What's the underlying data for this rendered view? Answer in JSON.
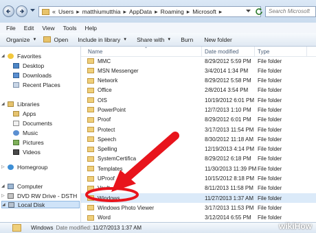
{
  "address": {
    "crumbs": [
      "Users",
      "matthiumutthia",
      "AppData",
      "Roaming",
      "Microsoft"
    ],
    "search_placeholder": "Search Microsoft"
  },
  "menu": [
    "File",
    "Edit",
    "View",
    "Tools",
    "Help"
  ],
  "toolbar": {
    "organize": "Organize",
    "open": "Open",
    "include": "Include in library",
    "share": "Share with",
    "burn": "Burn",
    "new_folder": "New folder"
  },
  "nav": {
    "favorites": "Favorites",
    "desktop": "Desktop",
    "downloads": "Downloads",
    "recent": "Recent Places",
    "libraries": "Libraries",
    "apps": "Apps",
    "documents": "Documents",
    "music": "Music",
    "pictures": "Pictures",
    "videos": "Videos",
    "homegroup": "Homegroup",
    "computer": "Computer",
    "dvd": "DVD RW Drive - DSTH",
    "local_disk": "Local Disk"
  },
  "columns": {
    "name": "Name",
    "date": "Date modified",
    "type": "Type"
  },
  "files": [
    {
      "name": "MMC",
      "date": "8/29/2012 5:59 PM",
      "type": "File folder"
    },
    {
      "name": "MSN Messenger",
      "date": "3/4/2014 1:34 PM",
      "type": "File folder"
    },
    {
      "name": "Network",
      "date": "8/29/2012 5:58 PM",
      "type": "File folder"
    },
    {
      "name": "Office",
      "date": "2/8/2014 3:54 PM",
      "type": "File folder"
    },
    {
      "name": "OIS",
      "date": "10/19/2012 6:01 PM",
      "type": "File folder"
    },
    {
      "name": "PowerPoint",
      "date": "12/7/2013 1:10 PM",
      "type": "File folder"
    },
    {
      "name": "Proof",
      "date": "8/29/2012 6:01 PM",
      "type": "File folder"
    },
    {
      "name": "Protect",
      "date": "3/17/2013 11:54 PM",
      "type": "File folder"
    },
    {
      "name": "Speech",
      "date": "8/30/2012 11:18 AM",
      "type": "File folder"
    },
    {
      "name": "Spelling",
      "date": "12/19/2013 4:14 PM",
      "type": "File folder"
    },
    {
      "name": "SystemCertifica",
      "date": "8/29/2012 6:18 PM",
      "type": "File folder"
    },
    {
      "name": "Templates",
      "date": "11/30/2013 11:39 PM",
      "type": "File folder"
    },
    {
      "name": "UProof",
      "date": "10/15/2012 8:18 PM",
      "type": "File folder"
    },
    {
      "name": "Vault",
      "date": "8/11/2013 11:58 PM",
      "type": "File folder"
    },
    {
      "name": "Windows",
      "date": "11/27/2013 1:37 AM",
      "type": "File folder"
    },
    {
      "name": "Windows Photo Viewer",
      "date": "3/17/2013 11:53 PM",
      "type": "File folder"
    },
    {
      "name": "Word",
      "date": "3/12/2014 6:55 PM",
      "type": "File folder"
    }
  ],
  "selected_index": 14,
  "details": {
    "name": "Windows",
    "label": "Date modified:",
    "value": "11/27/2013 1:37 AM"
  },
  "watermark": "wikiHow",
  "colors": {
    "annotation": "#e8141c",
    "selection": "#dbeaf9",
    "folder": "#efcf7a"
  }
}
